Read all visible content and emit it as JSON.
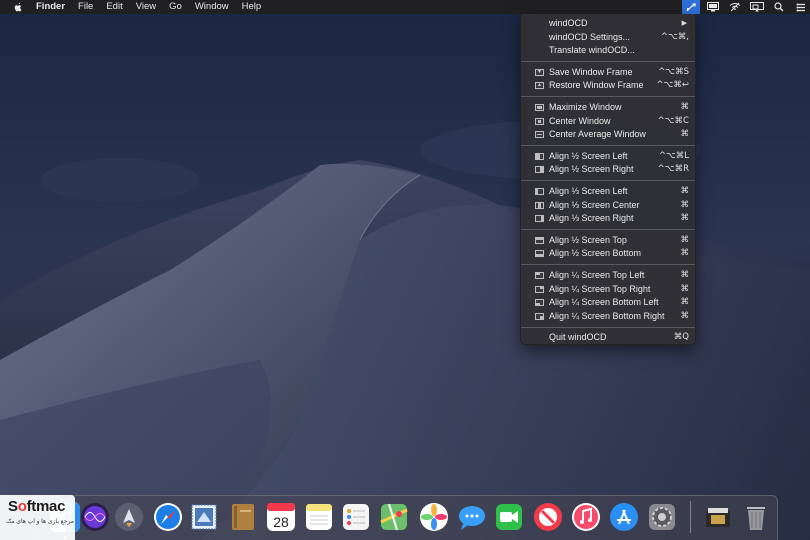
{
  "menubar": {
    "apple_icon": "apple-logo-icon",
    "items": [
      "Finder",
      "File",
      "Edit",
      "View",
      "Go",
      "Window",
      "Help"
    ],
    "status_icons": [
      "windocd-icon",
      "bezel-icon",
      "wifi-slash-icon",
      "airplay-icon",
      "search-icon",
      "control-center-icon"
    ]
  },
  "dropdown": {
    "groups": [
      [
        {
          "label": "windOCD",
          "shortcut": "",
          "submenu": true,
          "icon": ""
        },
        {
          "label": "windOCD Settings...",
          "shortcut": "^⌥⌘,",
          "icon": ""
        },
        {
          "label": "Translate windOCD...",
          "shortcut": "",
          "icon": ""
        }
      ],
      [
        {
          "label": "Save Window Frame",
          "shortcut": "^⌥⌘S",
          "icon": "save-frame-icon"
        },
        {
          "label": "Restore Window Frame",
          "shortcut": "^⌥⌘↩",
          "icon": "restore-frame-icon"
        }
      ],
      [
        {
          "label": "Maximize Window",
          "shortcut": "⌘",
          "icon": "maximize-icon"
        },
        {
          "label": "Center Window",
          "shortcut": "^⌥⌘C",
          "icon": "center-icon"
        },
        {
          "label": "Center Average Window",
          "shortcut": "⌘",
          "icon": "center-average-icon"
        }
      ],
      [
        {
          "label": "Align ½ Screen Left",
          "shortcut": "^⌥⌘L",
          "icon": "half-left-icon"
        },
        {
          "label": "Align ½ Screen Right",
          "shortcut": "^⌥⌘R",
          "icon": "half-right-icon"
        }
      ],
      [
        {
          "label": "Align ⅓ Screen Left",
          "shortcut": "⌘",
          "icon": "third-left-icon"
        },
        {
          "label": "Align ⅓ Screen Center",
          "shortcut": "⌘",
          "icon": "third-center-icon"
        },
        {
          "label": "Align ⅓ Screen Right",
          "shortcut": "⌘",
          "icon": "third-right-icon"
        }
      ],
      [
        {
          "label": "Align ½ Screen Top",
          "shortcut": "⌘",
          "icon": "half-top-icon"
        },
        {
          "label": "Align ½ Screen Bottom",
          "shortcut": "⌘",
          "icon": "half-bottom-icon"
        }
      ],
      [
        {
          "label": "Align ¼ Screen Top Left",
          "shortcut": "⌘",
          "icon": "quarter-top-left-icon"
        },
        {
          "label": "Align ¼ Screen Top Right",
          "shortcut": "⌘",
          "icon": "quarter-top-right-icon"
        },
        {
          "label": "Align ¼ Screen Bottom Left",
          "shortcut": "⌘",
          "icon": "quarter-bottom-left-icon"
        },
        {
          "label": "Align ¼ Screen Bottom Right",
          "shortcut": "⌘",
          "icon": "quarter-bottom-right-icon"
        }
      ],
      [
        {
          "label": "Quit windOCD",
          "shortcut": "⌘Q",
          "icon": ""
        }
      ]
    ]
  },
  "dock": {
    "apps": [
      {
        "name": "finder-icon",
        "color": "#2b8ef0",
        "running": true
      },
      {
        "name": "siri-icon",
        "color": "#6a3ad8"
      },
      {
        "name": "launchpad-icon",
        "color": "#5a6070"
      },
      {
        "name": "safari-icon",
        "color": "#1e7ee8"
      },
      {
        "name": "mail-stamp-icon",
        "color": "#4a7ab8"
      },
      {
        "name": "notebook-icon",
        "color": "#b08040"
      },
      {
        "name": "calendar-icon",
        "color": "#ffffff",
        "text": "28"
      },
      {
        "name": "notes-icon",
        "color": "#f6e27a"
      },
      {
        "name": "reminders-icon",
        "color": "#f4f4f4"
      },
      {
        "name": "maps-icon",
        "color": "#6bbf6b"
      },
      {
        "name": "photos-icon",
        "color": "#ffffff"
      },
      {
        "name": "messages-icon",
        "color": "#38a0f8"
      },
      {
        "name": "facetime-icon",
        "color": "#2fbf4a"
      },
      {
        "name": "news-icon",
        "color": "#f33a4a"
      },
      {
        "name": "music-icon",
        "color": "#f84a6a"
      },
      {
        "name": "app-store-icon",
        "color": "#2a8ff5"
      },
      {
        "name": "system-preferences-icon",
        "color": "#8a8a8e"
      }
    ],
    "right": [
      {
        "name": "downloads-stack-icon",
        "color": "#3a3a3a"
      },
      {
        "name": "trash-icon",
        "color": "#9a9a9e"
      }
    ]
  },
  "watermark": {
    "logo_prefix": "S",
    "logo_o": "o",
    "logo_suffix": "ftmac",
    "subtitle": "مرجع بازی ها و اپ های مک"
  }
}
